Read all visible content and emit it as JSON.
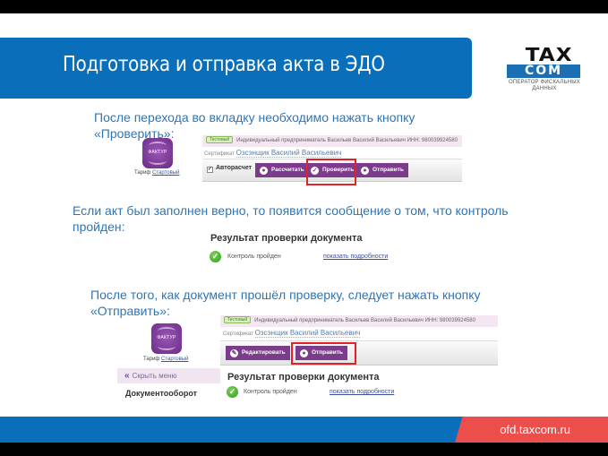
{
  "slide": {
    "title": "Подготовка и отправка акта в ЭДО",
    "logo": {
      "line1": "TAX",
      "line2": "COM",
      "subtitle_line1": "ОПЕРАТОР ФИСКАЛЬНЫХ",
      "subtitle_line2": "ДАННЫХ"
    },
    "footer_url": "ofd.taxcom.ru",
    "colors": {
      "primary_blue": "#0A6FBA",
      "accent_red": "#EB4E4B",
      "text_blue": "#2E75B6",
      "button_purple": "#7d3b8c",
      "highlight_red": "#e32227"
    }
  },
  "steps": [
    {
      "text_line1": "После перехода во вкладку необходимо нажать кнопку",
      "text_line2": "«Проверить»:"
    },
    {
      "text_line1": "Если акт был заполнен верно, то появится сообщение о том, что контроль",
      "text_line2": "пройден:"
    },
    {
      "text_line1": "После того, как документ прошёл проверку, следует нажать кнопку",
      "text_line2": "«Отправить»:"
    }
  ],
  "app": {
    "logo_text": "ФАКТУР",
    "tariff_label": "Тариф",
    "tariff_value": "Стартовый",
    "badge_test": "Тестовый",
    "org_line": "Индивидуальный предприниматель Васильев Василий Васильевич ИНН: 980039924580",
    "signer_label": "Сертификат",
    "signer_name": "Озсэнщик Василий Васильевич",
    "autocalc_label": "Авторасчет",
    "buttons": {
      "calculate": "Рассчитать",
      "check": "Проверить",
      "send": "Отправить",
      "edit": "Редактировать"
    },
    "result_title": "Результат проверки документа",
    "result_status": "Контроль пройден",
    "details_link": "показать подробности",
    "hide_menu": "Скрыть меню",
    "menu_section": "Документооборот"
  }
}
